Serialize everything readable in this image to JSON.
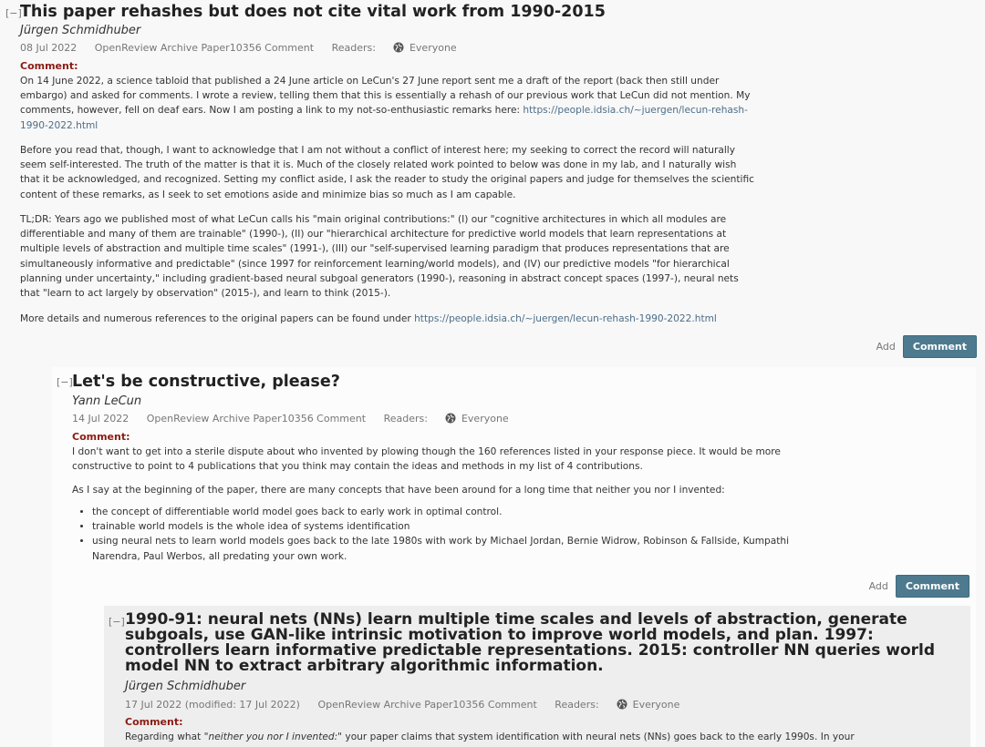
{
  "note1": {
    "toggle": "[−]",
    "title": "This paper rehashes but does not cite vital work from 1990-2015",
    "author": "Jürgen Schmidhuber",
    "date": "08 Jul 2022",
    "source": "OpenReview Archive Paper10356 Comment",
    "readers_label": "Readers:",
    "readers_value": "Everyone",
    "comment_label": "Comment:",
    "p1_text": "On 14 June 2022, a science tabloid that published a 24 June article on LeCun's 27 June report sent me a draft of the report (back then still under embargo) and asked for comments. I wrote a review, telling them that this is essentially a rehash of our previous work that LeCun did not mention. My comments, however, fell on deaf ears. Now I am posting a link to my not-so-enthusiastic remarks here: ",
    "p1_link": "https://people.idsia.ch/~juergen/lecun-rehash-1990-2022.html",
    "p2": "Before you read that, though, I want to acknowledge that I am not without a conflict of interest here; my seeking to correct the record will naturally seem self-interested. The truth of the matter is that it is. Much of the closely related work pointed to below was done in my lab, and I naturally wish that it be acknowledged, and recognized. Setting my conflict aside, I ask the reader to study the original papers and judge for themselves the scientific content of these remarks, as I seek to set emotions aside and minimize bias so much as I am capable.",
    "p3": "TL;DR: Years ago we published most of what LeCun calls his \"main original contributions:\" (I) our \"cognitive architectures in which all modules are differentiable and many of them are trainable\" (1990-), (II) our \"hierarchical architecture for predictive world models that learn representations at multiple levels of abstraction and multiple time scales\" (1991-), (III) our \"self-supervised learning paradigm that produces representations that are simultaneously informative and predictable\" (since 1997 for reinforcement learning/world models), and (IV) our predictive models \"for hierarchical planning under uncertainty,\" including gradient-based neural subgoal generators (1990-), reasoning in abstract concept spaces (1997-), neural nets that \"learn to act largely by observation\" (2015-), and learn to think (2015-).",
    "p4_text": "More details and numerous references to the original papers can be found under ",
    "p4_link": "https://people.idsia.ch/~juergen/lecun-rehash-1990-2022.html",
    "add_label": "Add",
    "comment_button": "Comment"
  },
  "note2": {
    "toggle": "[−]",
    "title": "Let's be constructive, please?",
    "author": "Yann LeCun",
    "date": "14 Jul 2022",
    "source": "OpenReview Archive Paper10356 Comment",
    "readers_label": "Readers:",
    "readers_value": "Everyone",
    "comment_label": "Comment:",
    "p1": "I don't want to get into a sterile dispute about who invented by plowing though the 160 references listed in your response piece. It would be more constructive to point to 4 publications that you think may contain the ideas and methods in my list of 4 contributions.",
    "p2": "As I say at the beginning of the paper, there are many concepts that have been around for a long time that neither you nor I invented:",
    "bullets": [
      "the concept of differentiable world model goes back to early work in optimal control.",
      "trainable world models is the whole idea of systems identification",
      "using neural nets to learn world models goes back to the late 1980s with work by Michael Jordan, Bernie Widrow, Robinson & Fallside, Kumpathi Narendra, Paul Werbos, all predating your own work."
    ],
    "add_label": "Add",
    "comment_button": "Comment"
  },
  "note3": {
    "toggle": "[−]",
    "title": "1990-91: neural nets (NNs) learn multiple time scales and levels of abstraction, generate subgoals, use GAN-like intrinsic motivation to improve world models, and plan. 1997: controllers learn informative predictable representations. 2015: controller NN queries world model NN to extract arbitrary algorithmic information.",
    "author": "Jürgen Schmidhuber",
    "date": "17 Jul 2022 (modified: 17 Jul 2022)",
    "source": "OpenReview Archive Paper10356 Comment",
    "readers_label": "Readers:",
    "readers_value": "Everyone",
    "comment_label": "Comment:",
    "p1_pre": "Regarding what ",
    "p1_quote": "\"neither you nor I invented:\"",
    "p1_post": " your paper claims that system identification with neural nets (NNs) goes back to the early 1990s. In your"
  }
}
